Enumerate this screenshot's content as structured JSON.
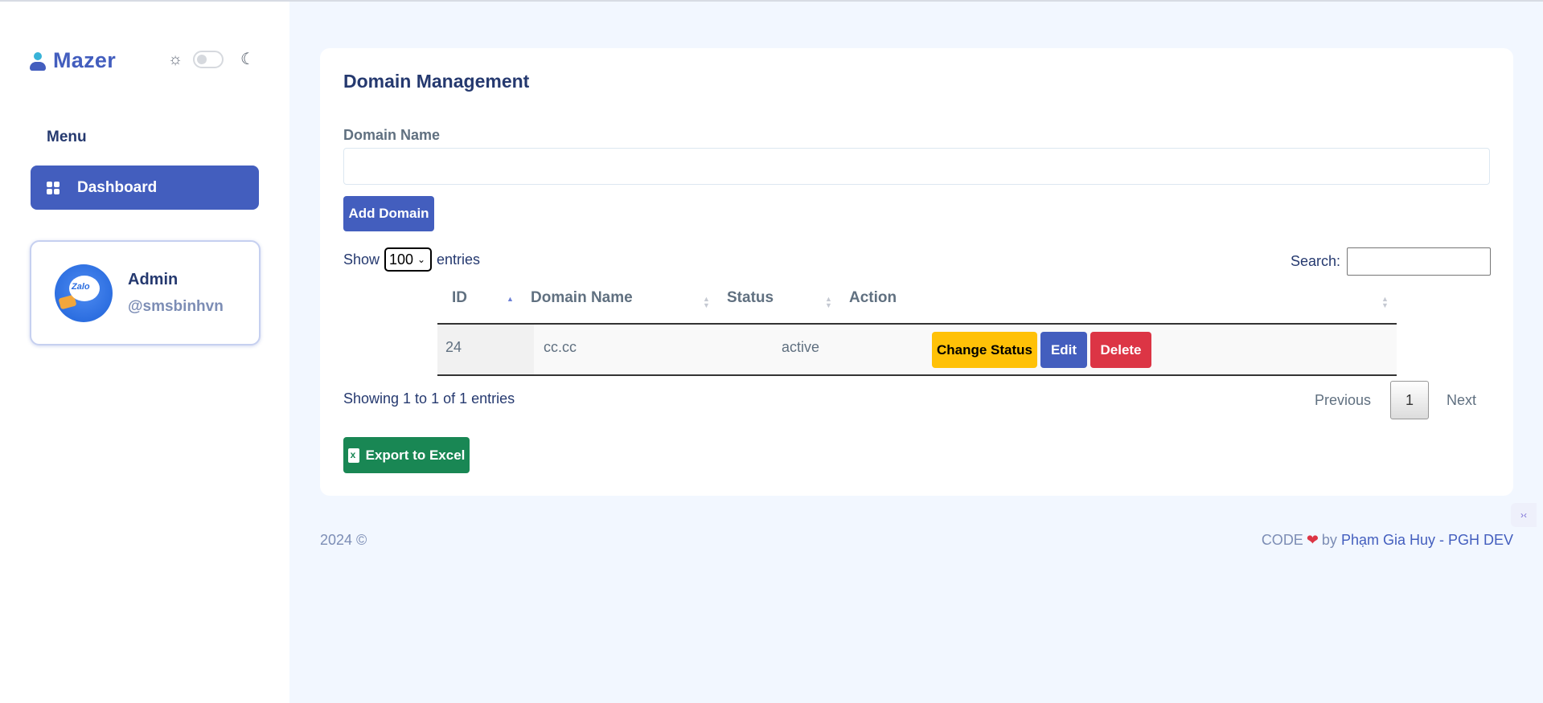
{
  "brand": {
    "name": "Mazer"
  },
  "sidebar": {
    "menu_title": "Menu",
    "items": [
      {
        "label": "Dashboard",
        "icon": "grid-icon",
        "active": true
      }
    ],
    "profile": {
      "name": "Admin",
      "handle": "@smsbinhvn"
    }
  },
  "page": {
    "title": "Domain Management",
    "domain_field_label": "Domain Name",
    "domain_field_value": "",
    "add_button": "Add Domain"
  },
  "table_controls": {
    "show_label": "Show",
    "entries_value": "100",
    "entries_label": "entries",
    "search_label": "Search:",
    "search_value": ""
  },
  "table": {
    "headers": [
      "ID",
      "Domain Name",
      "Status",
      "Action"
    ],
    "rows": [
      {
        "id": "24",
        "domain": "cc.cc",
        "status": "active"
      }
    ],
    "actions": {
      "change_status": "Change Status",
      "edit": "Edit",
      "delete": "Delete"
    }
  },
  "pagination": {
    "info": "Showing 1 to 1 of 1 entries",
    "previous": "Previous",
    "current_page": "1",
    "next": "Next"
  },
  "export_button": "Export to Excel",
  "footer": {
    "copyright": "2024 ©",
    "code_label": "CODE",
    "by_label": "by",
    "author": "Phạm Gia Huy - PGH DEV"
  },
  "colors": {
    "primary": "#435ebe",
    "warning": "#ffc107",
    "danger": "#dc3545",
    "success": "#198754",
    "background": "#f2f7ff"
  }
}
